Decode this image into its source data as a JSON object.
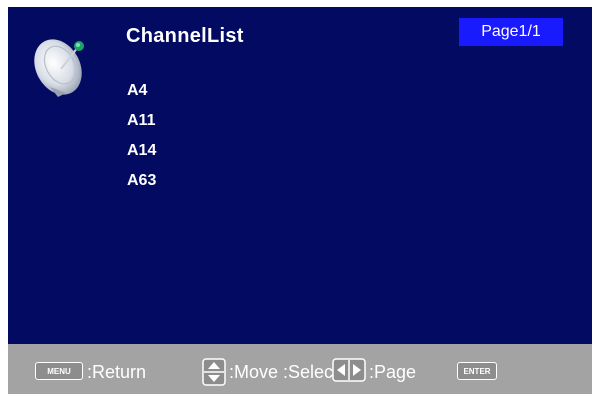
{
  "header": {
    "title": "ChannelList",
    "page_indicator": "Page1/1"
  },
  "channels": [
    "A4",
    "A11",
    "A14",
    "A63"
  ],
  "footer": {
    "menu_key": "MENU",
    "return_label": ":Return",
    "move_label": ":Move",
    "select_label": ":Select",
    "page_label": ":Page",
    "enter_key": "ENTER"
  },
  "colors": {
    "screen_bg": "#020a62",
    "badge_bg": "#1a1aff",
    "footer_bg": "#a3a3a3",
    "text": "#ffffff"
  },
  "icons": [
    "satellite-dish-icon",
    "up-down-arrows-icon",
    "left-right-arrows-icon"
  ]
}
